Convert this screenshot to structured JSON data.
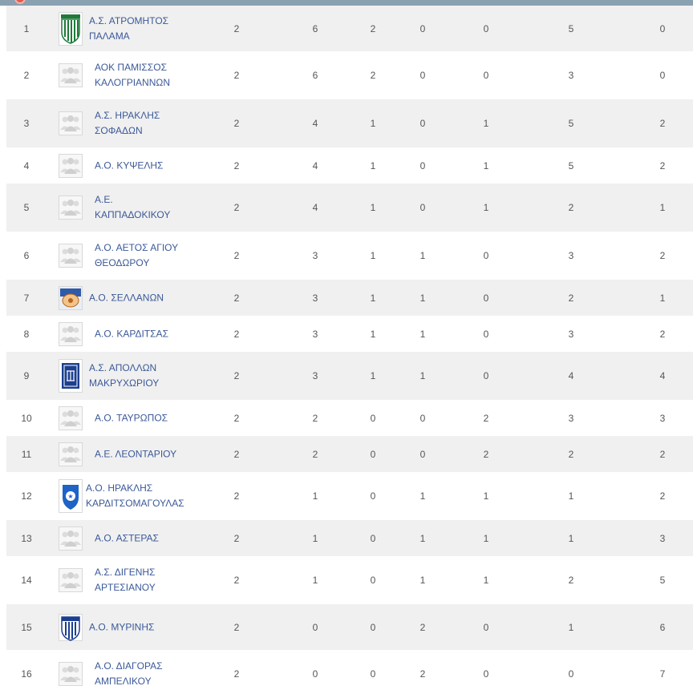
{
  "colors": {
    "header_bar": "#8aa1b1",
    "row_alt": "#f0f0f0",
    "team_link": "#3b5998",
    "text": "#555555"
  },
  "rows": [
    {
      "rank": "1",
      "name_l1": "Α.Σ. ΑΤΡΟΜΗΤΟΣ",
      "name_l2": "ΠΑΛΑΜΑ",
      "logo": "atromitos-crest-icon",
      "v": [
        "2",
        "6",
        "2",
        "0",
        "0",
        "5",
        "0"
      ]
    },
    {
      "rank": "2",
      "name_l1": "ΑΟΚ ΠΑΜΙΣΣΟΣ",
      "name_l2": "ΚΑΛΟΓΡΙΑΝΝΩΝ",
      "logo": "team-placeholder-icon",
      "v": [
        "2",
        "6",
        "2",
        "0",
        "0",
        "3",
        "0"
      ]
    },
    {
      "rank": "3",
      "name_l1": "Α.Σ. ΗΡΑΚΛΗΣ",
      "name_l2": "ΣΟΦΑΔΩΝ",
      "logo": "team-placeholder-icon",
      "v": [
        "2",
        "4",
        "1",
        "0",
        "1",
        "5",
        "2"
      ]
    },
    {
      "rank": "4",
      "name_l1": "Α.Ο. ΚΥΨΕΛΗΣ",
      "name_l2": "",
      "logo": "team-placeholder-icon",
      "v": [
        "2",
        "4",
        "1",
        "0",
        "1",
        "5",
        "2"
      ]
    },
    {
      "rank": "5",
      "name_l1": "Α.Ε.",
      "name_l2": "ΚΑΠΠΑΔΟΚΙΚΟΥ",
      "logo": "team-placeholder-icon",
      "v": [
        "2",
        "4",
        "1",
        "0",
        "1",
        "2",
        "1"
      ]
    },
    {
      "rank": "6",
      "name_l1": "Α.Ο. ΑΕΤΟΣ ΑΓΙΟΥ",
      "name_l2": "ΘΕΟΔΩΡΟΥ",
      "logo": "team-placeholder-icon",
      "v": [
        "2",
        "3",
        "1",
        "1",
        "0",
        "3",
        "2"
      ]
    },
    {
      "rank": "7",
      "name_l1": "Α.Ο. ΣΕΛΛΑΝΩΝ",
      "name_l2": "",
      "logo": "sellanon-crest-icon",
      "v": [
        "2",
        "3",
        "1",
        "1",
        "0",
        "2",
        "1"
      ]
    },
    {
      "rank": "8",
      "name_l1": "Α.Ο. ΚΑΡΔΙΤΣΑΣ",
      "name_l2": "",
      "logo": "team-placeholder-icon",
      "v": [
        "2",
        "3",
        "1",
        "1",
        "0",
        "3",
        "2"
      ]
    },
    {
      "rank": "9",
      "name_l1": "Α.Σ. ΑΠΟΛΛΩΝ",
      "name_l2": "ΜΑΚΡΥΧΩΡΙΟΥ",
      "logo": "apollon-crest-icon",
      "v": [
        "2",
        "3",
        "1",
        "1",
        "0",
        "4",
        "4"
      ]
    },
    {
      "rank": "10",
      "name_l1": "Α.Ο. ΤΑΥΡΩΠΟΣ",
      "name_l2": "",
      "logo": "team-placeholder-icon",
      "v": [
        "2",
        "2",
        "0",
        "0",
        "2",
        "3",
        "3"
      ]
    },
    {
      "rank": "11",
      "name_l1": "Α.Ε. ΛΕΟΝΤΑΡΙΟΥ",
      "name_l2": "",
      "logo": "team-placeholder-icon",
      "v": [
        "2",
        "2",
        "0",
        "0",
        "2",
        "2",
        "2"
      ]
    },
    {
      "rank": "12",
      "name_l1": "Α.Ο. ΗΡΑΚΛΗΣ",
      "name_l2": "ΚΑΡΔΙΤΣΟΜΑΓΟΥΛΑΣ",
      "logo": "iraklis-crest-icon",
      "v": [
        "2",
        "1",
        "0",
        "1",
        "1",
        "1",
        "2"
      ]
    },
    {
      "rank": "13",
      "name_l1": "Α.Ο. ΑΣΤΕΡΑΣ",
      "name_l2": "",
      "logo": "team-placeholder-icon",
      "v": [
        "2",
        "1",
        "0",
        "1",
        "1",
        "1",
        "3"
      ]
    },
    {
      "rank": "14",
      "name_l1": "Α.Σ. ΔΙΓΕΝΗΣ",
      "name_l2": "ΑΡΤΕΣΙΑΝΟΥ",
      "logo": "team-placeholder-icon",
      "v": [
        "2",
        "1",
        "0",
        "1",
        "1",
        "2",
        "5"
      ]
    },
    {
      "rank": "15",
      "name_l1": "Α.Ο. ΜΥΡΙΝΗΣ",
      "name_l2": "",
      "logo": "myrini-crest-icon",
      "v": [
        "2",
        "0",
        "0",
        "2",
        "0",
        "1",
        "6"
      ]
    },
    {
      "rank": "16",
      "name_l1": "Α.Ο. ΔΙΑΓΟΡΑΣ",
      "name_l2": "ΑΜΠΕΛΙΚΟΥ",
      "logo": "team-placeholder-icon",
      "v": [
        "2",
        "0",
        "0",
        "2",
        "0",
        "0",
        "7"
      ]
    }
  ]
}
